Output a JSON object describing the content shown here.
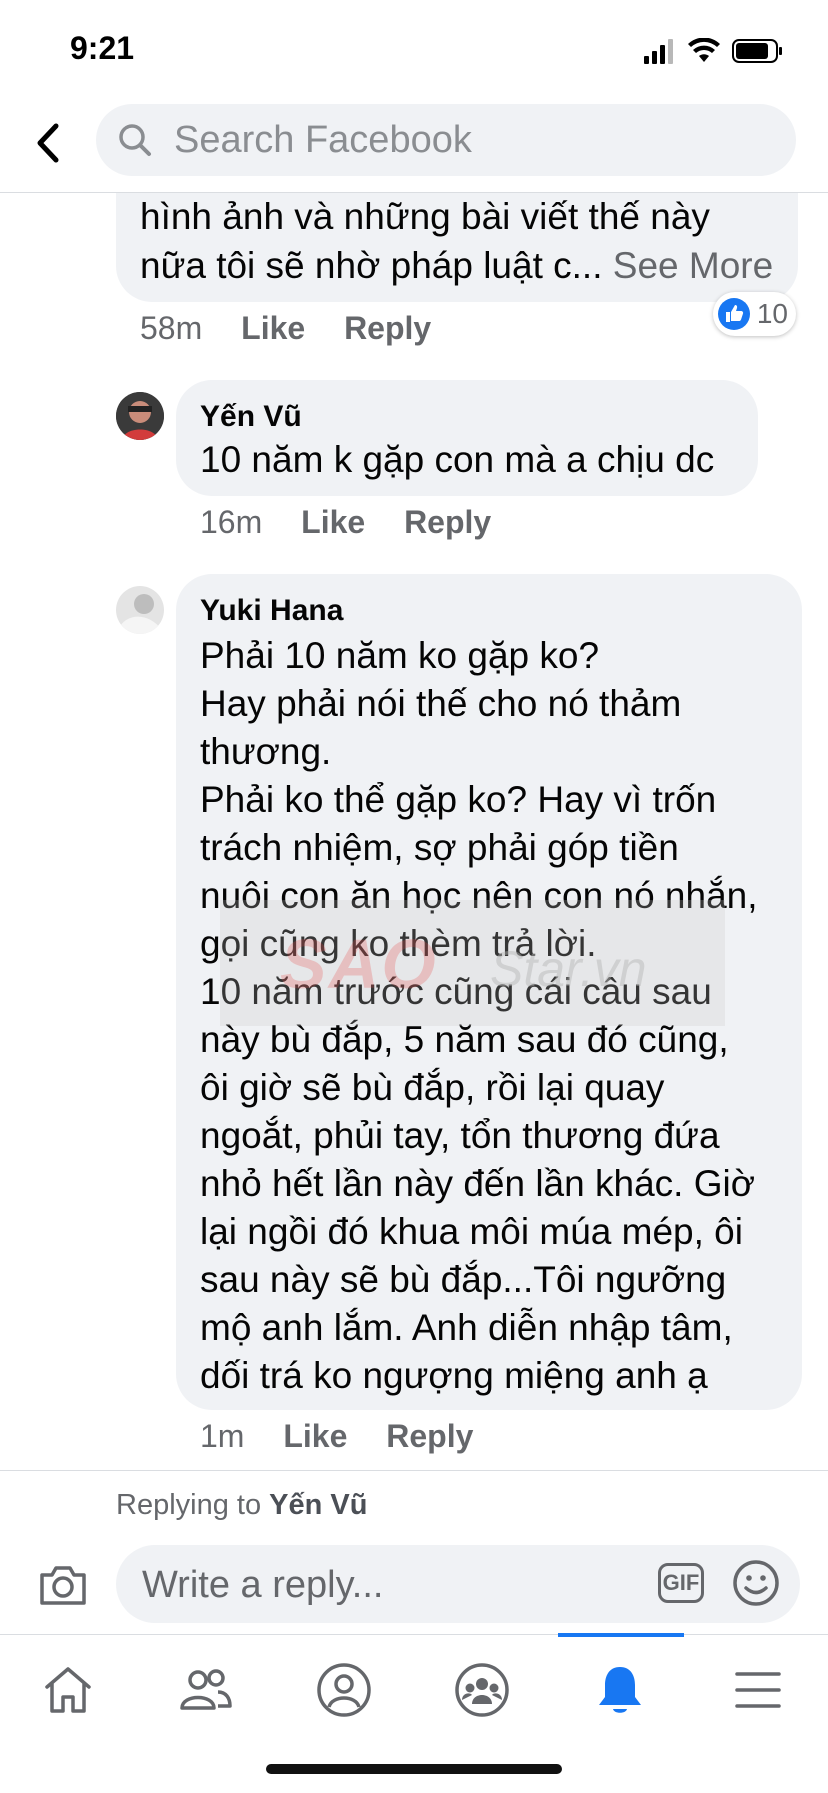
{
  "status_bar": {
    "time": "9:21"
  },
  "header": {
    "search_placeholder": "Search Facebook"
  },
  "comments": [
    {
      "text": "hình ảnh và những bài viết thế này\nnữa tôi sẽ nhờ pháp luật c...",
      "see_more": "See More",
      "time": "58m",
      "like": "Like",
      "reply": "Reply",
      "reaction_count": "10"
    },
    {
      "name": "Yến Vũ",
      "text": "10 năm k gặp con mà a chịu dc",
      "time": "16m",
      "like": "Like",
      "reply": "Reply"
    },
    {
      "name": "Yuki Hana",
      "text": "Phải 10 năm ko gặp ko?\nHay phải nói thế cho nó thảm\nthương.\nPhải ko thể gặp ko? Hay vì trốn\ntrách nhiệm, sợ phải góp tiền\nnuôi con ăn học nên con nó nhắn,\ngọi cũng ko thèm trả lời.\n10 năm trước cũng cái câu sau\nnày bù đắp, 5 năm sau đó cũng,\nôi giờ sẽ bù đắp, rồi lại quay\nngoắt, phủi tay, tổn thương đứa\nnhỏ hết lần này đến lần khác. Giờ\nlại ngồi đó khua môi múa mép, ôi\nsau này sẽ bù đắp...Tôi ngưỡng\nmộ anh lắm. Anh diễn nhập tâm,\ndối trá ko ngượng miệng anh ạ",
      "time": "1m",
      "like": "Like",
      "reply": "Reply"
    }
  ],
  "watermark": {
    "brand": "SAO",
    "sub": "Star.vn"
  },
  "reply_bar": {
    "replying_prefix": "Replying to",
    "replying_name": "Yến Vũ",
    "input_placeholder": "Write a reply...",
    "gif_label": "GIF"
  },
  "bottom_nav": [
    "home-icon",
    "friends-icon",
    "profile-icon",
    "groups-icon",
    "notifications-icon",
    "menu-icon"
  ],
  "colors": {
    "accent": "#1877f2",
    "bubble": "#f0f2f5",
    "meta": "#65676b"
  }
}
